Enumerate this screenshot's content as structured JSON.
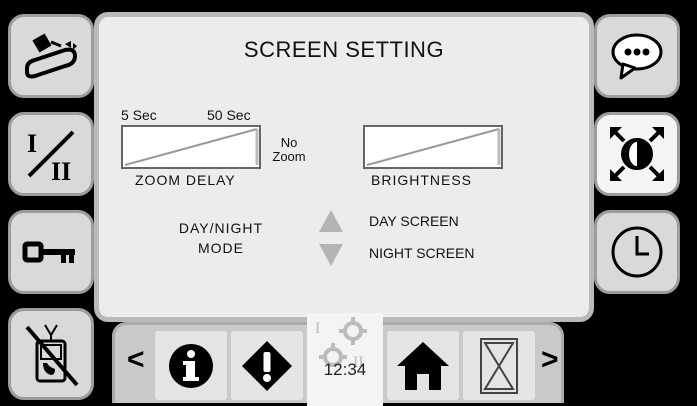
{
  "panel": {
    "title": "SCREEN SETTING",
    "zoom_delay": {
      "min_label": "5 Sec",
      "max_label": "50 Sec",
      "no_zoom_line1": "No",
      "no_zoom_line2": "Zoom",
      "label": "ZOOM DELAY"
    },
    "brightness": {
      "label": "BRIGHTNESS"
    },
    "day_night": {
      "label_line1": "DAY/NIGHT",
      "label_line2": "MODE",
      "day_label": "DAY SCREEN",
      "night_label": "NIGHT SCREEN"
    }
  },
  "bottom_bar": {
    "prev_label": "<",
    "next_label": ">",
    "clock_time": "12:34"
  },
  "colors": {
    "background": "#000000",
    "panel": "#ececec",
    "button": "#d9d9d9",
    "arrow_gray": "#b4b4b4"
  },
  "icons": [
    "calibrate-icon",
    "shift-i-ii-icon",
    "key-icon",
    "no-phone-icon",
    "message-icon",
    "contrast-zoom-icon",
    "clock-icon",
    "info-icon",
    "warning-icon",
    "settings-gear-icon",
    "home-icon",
    "hourglass-icon"
  ]
}
